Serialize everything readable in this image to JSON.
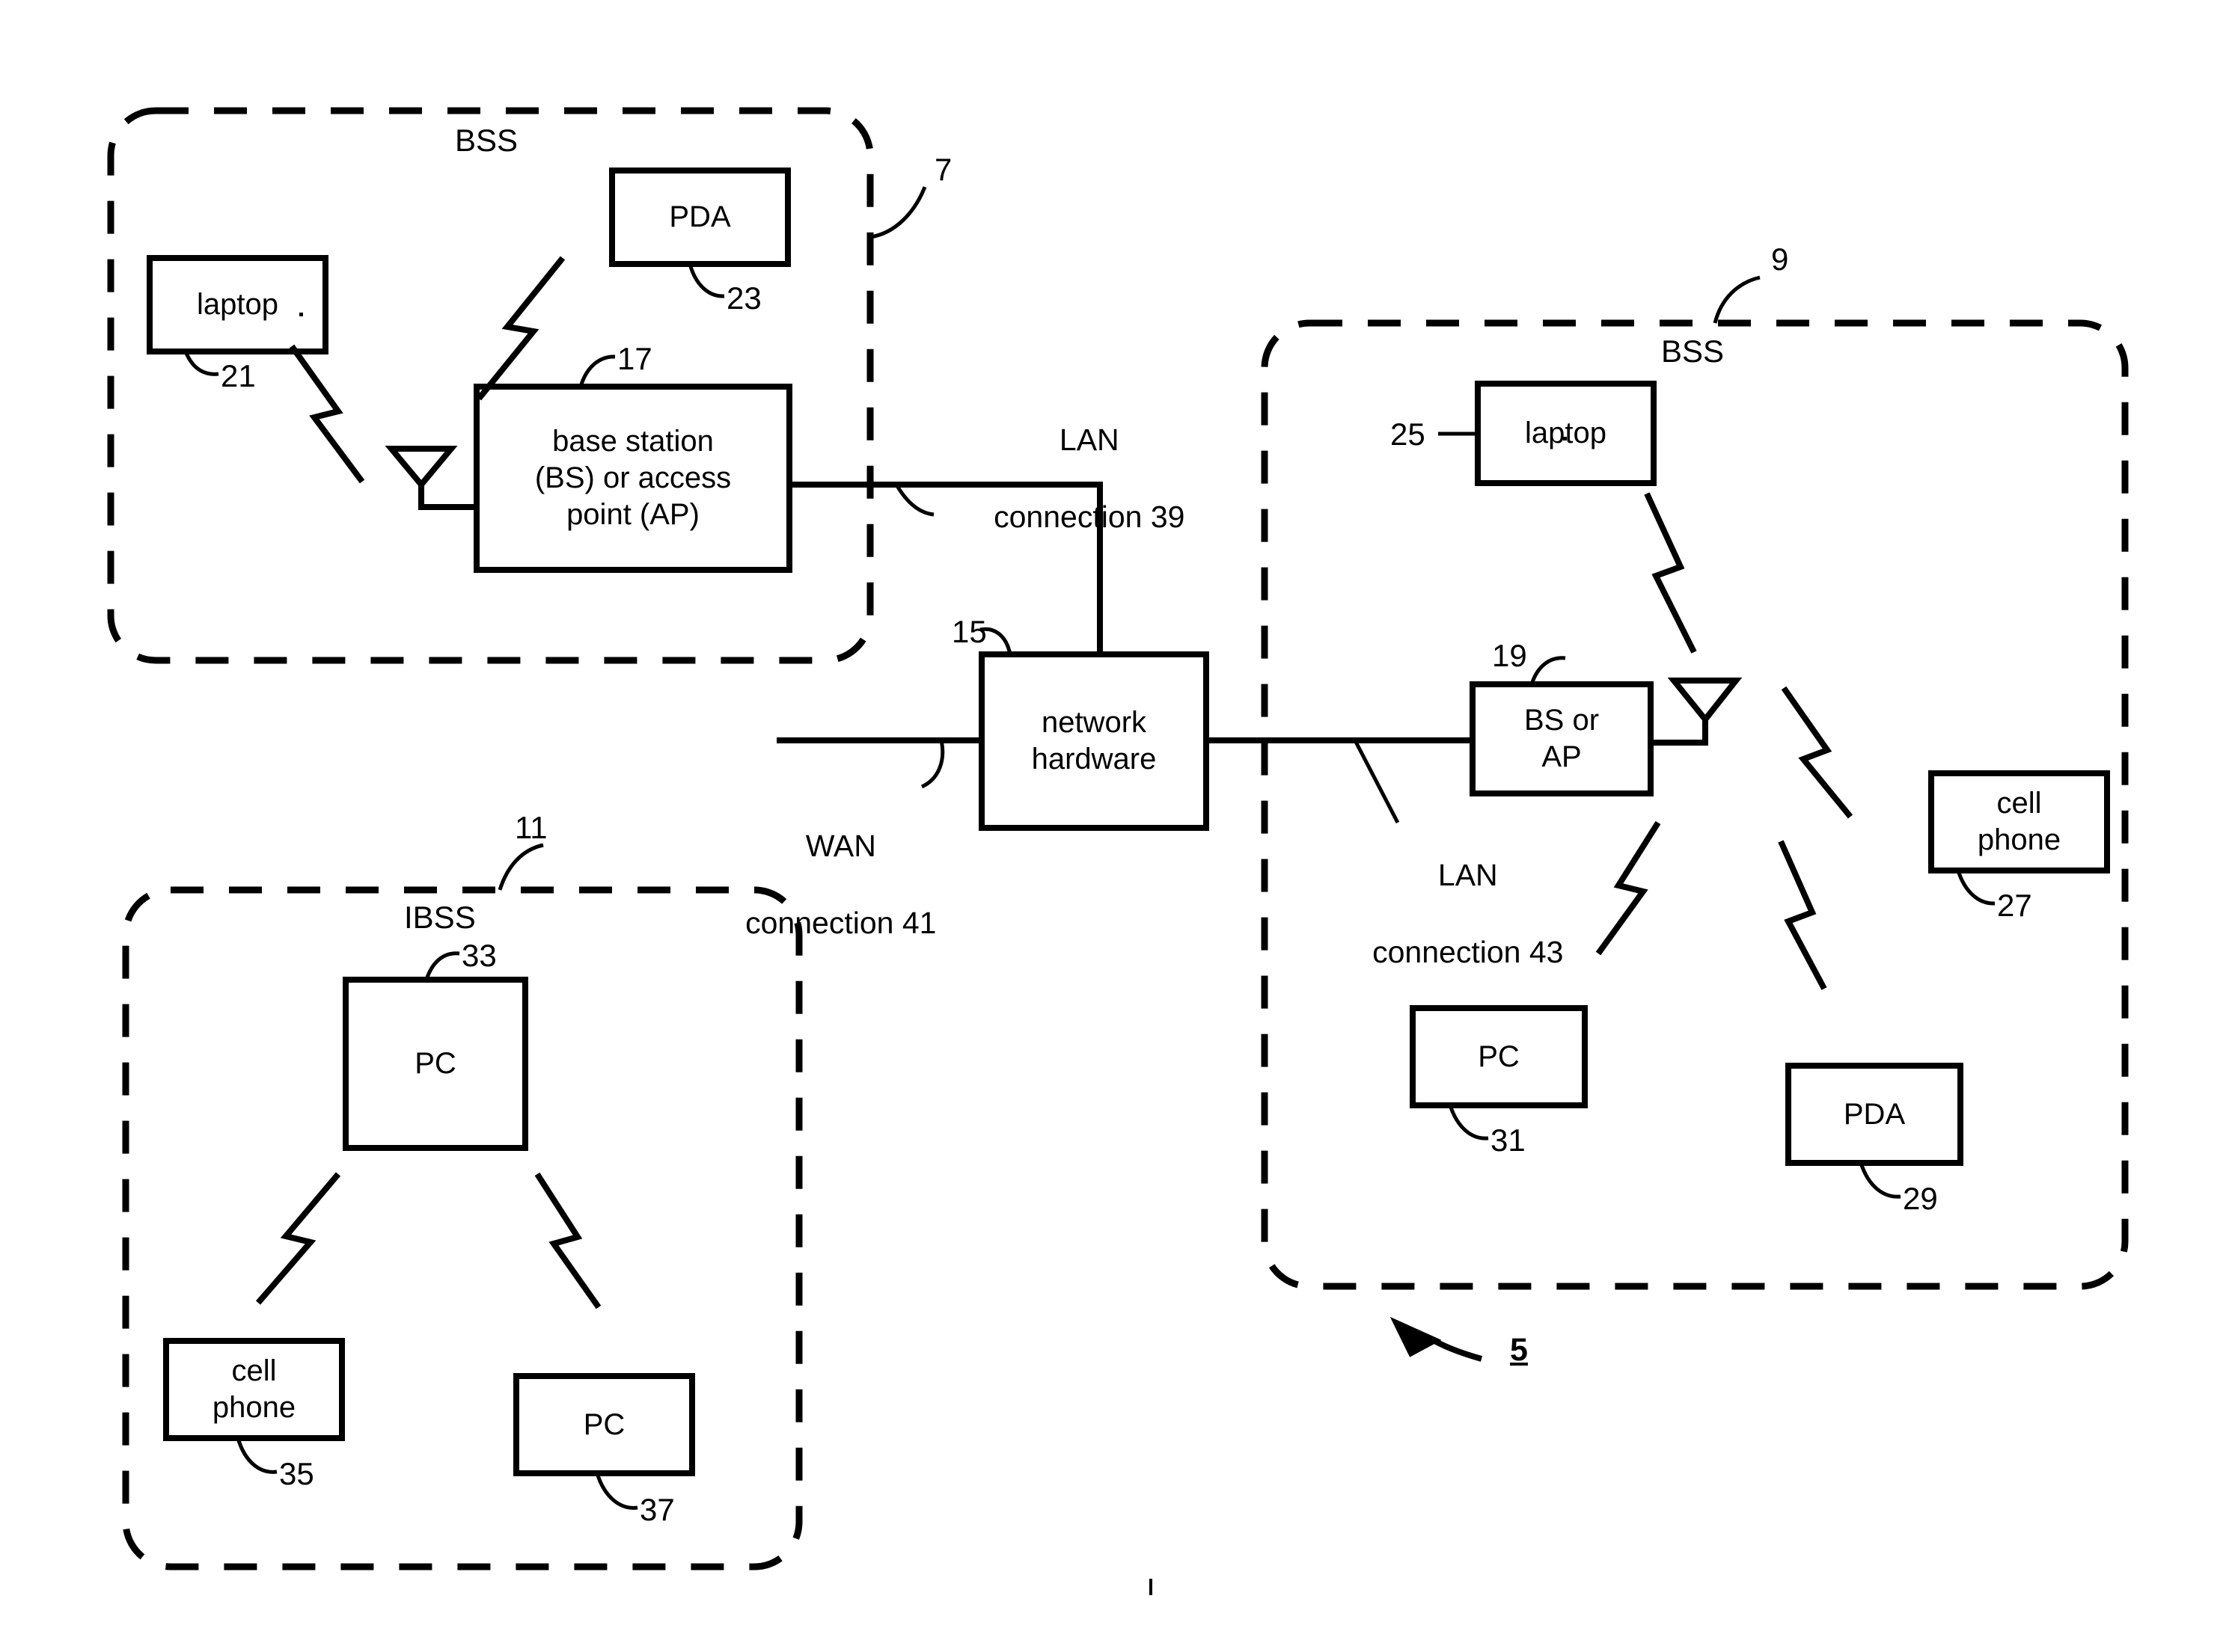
{
  "figure": {
    "figure_ref": "5",
    "zones": [
      {
        "id": "bss-left",
        "name": "BSS",
        "ref": "7"
      },
      {
        "id": "bss-right",
        "name": "BSS",
        "ref": "9"
      },
      {
        "id": "ibss",
        "name": "IBSS",
        "ref": "11"
      }
    ],
    "nodes": [
      {
        "id": "laptop-21",
        "label": "laptop",
        "ref": "21"
      },
      {
        "id": "pda-23",
        "label": "PDA",
        "ref": "23"
      },
      {
        "id": "bs-ap-17",
        "label": "base station\n(BS) or access\npoint (AP)",
        "ref": "17"
      },
      {
        "id": "network-hw-15",
        "label": "network\nhardware",
        "ref": "15"
      },
      {
        "id": "laptop-25",
        "label": "laptop",
        "ref": "25"
      },
      {
        "id": "bs-ap-19",
        "label": "BS or\nAP",
        "ref": "19"
      },
      {
        "id": "cell-phone-27",
        "label": "cell\nphone",
        "ref": "27"
      },
      {
        "id": "pda-29",
        "label": "PDA",
        "ref": "29"
      },
      {
        "id": "pc-31",
        "label": "PC",
        "ref": "31"
      },
      {
        "id": "pc-33",
        "label": "PC",
        "ref": "33"
      },
      {
        "id": "cell-phone-35",
        "label": "cell\nphone",
        "ref": "35"
      },
      {
        "id": "pc-37",
        "label": "PC",
        "ref": "37"
      }
    ],
    "connections": [
      {
        "id": "lan-39",
        "line1": "LAN",
        "line2": "connection 39"
      },
      {
        "id": "wan-41",
        "line1": "WAN",
        "line2": "connection 41"
      },
      {
        "id": "lan-43",
        "line1": "LAN",
        "line2": "connection 43"
      }
    ],
    "colors": {
      "ink": "#000000",
      "paper": "#ffffff"
    }
  }
}
